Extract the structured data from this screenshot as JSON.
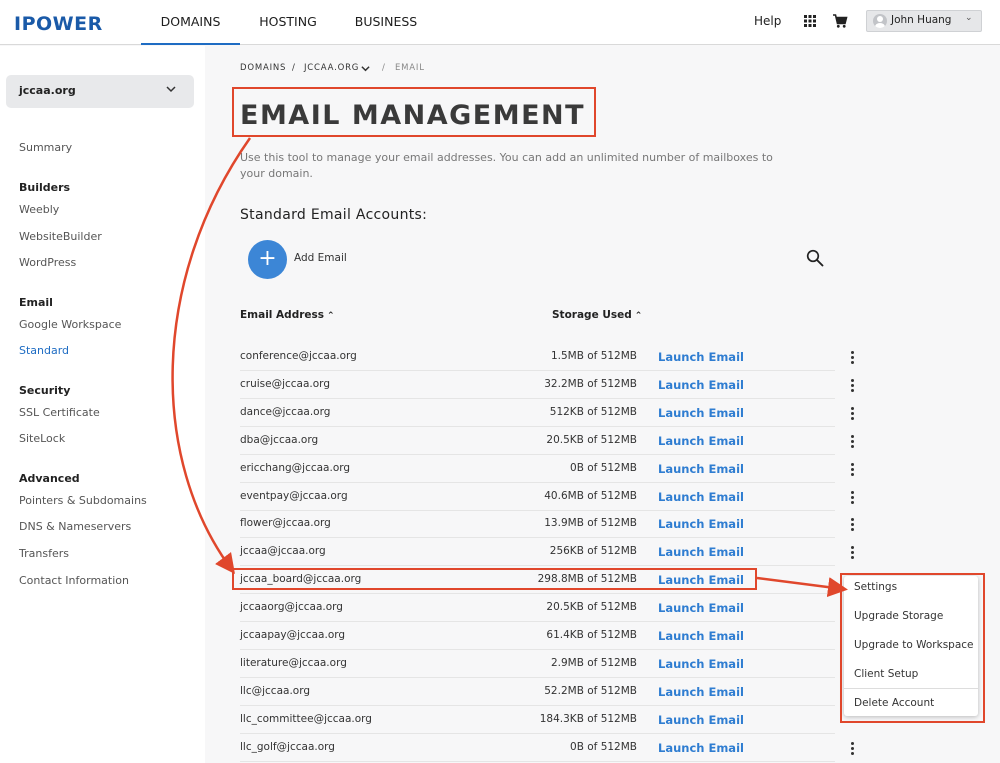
{
  "brand": {
    "logo_text": "IPOWER",
    "accent": "#1e6cc3",
    "annotation_color": "#e0472c"
  },
  "nav": {
    "tabs": [
      {
        "label": "DOMAINS",
        "active": true
      },
      {
        "label": "HOSTING",
        "active": false
      },
      {
        "label": "BUSINESS",
        "active": false
      }
    ],
    "help": "Help",
    "grid_icon": "apps-grid-icon",
    "cart_icon": "cart-icon",
    "user": "John Huang"
  },
  "sidebar": {
    "domain": "jccaa.org",
    "summary": "Summary",
    "groups": [
      {
        "heading": "Builders",
        "items": [
          "Weebly",
          "WebsiteBuilder",
          "WordPress"
        ]
      },
      {
        "heading": "Email",
        "items": [
          "Google Workspace",
          "Standard"
        ]
      },
      {
        "heading": "Security",
        "items": [
          "SSL Certificate",
          "SiteLock"
        ]
      },
      {
        "heading": "Advanced",
        "items": [
          "Pointers & Subdomains",
          "DNS & Nameservers",
          "Transfers",
          "Contact Information"
        ]
      }
    ],
    "active_item": "Standard"
  },
  "breadcrumb": {
    "first": "DOMAINS",
    "sep1": "/",
    "second": "JCCAA.ORG",
    "sep2": "/",
    "last": "EMAIL"
  },
  "main": {
    "title": "EMAIL MANAGEMENT",
    "description": "Use this tool to manage your email addresses. You can add an unlimited number of mailboxes to your domain.",
    "section_title": "Standard Email Accounts:",
    "add_email": "Add Email",
    "col_email": "Email Address",
    "col_storage": "Storage Used",
    "launch_label": "Launch Email"
  },
  "accounts": [
    {
      "email": "conference@jccaa.org",
      "storage": "1.5MB of 512MB"
    },
    {
      "email": "cruise@jccaa.org",
      "storage": "32.2MB of 512MB"
    },
    {
      "email": "dance@jccaa.org",
      "storage": "512KB of 512MB"
    },
    {
      "email": "dba@jccaa.org",
      "storage": "20.5KB of 512MB"
    },
    {
      "email": "ericchang@jccaa.org",
      "storage": "0B of 512MB"
    },
    {
      "email": "eventpay@jccaa.org",
      "storage": "40.6MB of 512MB"
    },
    {
      "email": "flower@jccaa.org",
      "storage": "13.9MB of 512MB"
    },
    {
      "email": "jccaa@jccaa.org",
      "storage": "256KB of 512MB"
    },
    {
      "email": "jccaa_board@jccaa.org",
      "storage": "298.8MB of 512MB"
    },
    {
      "email": "jccaaorg@jccaa.org",
      "storage": "20.5KB of 512MB"
    },
    {
      "email": "jccaapay@jccaa.org",
      "storage": "61.4KB of 512MB"
    },
    {
      "email": "literature@jccaa.org",
      "storage": "2.9MB of 512MB"
    },
    {
      "email": "llc@jccaa.org",
      "storage": "52.2MB of 512MB"
    },
    {
      "email": "llc_committee@jccaa.org",
      "storage": "184.3KB of 512MB"
    },
    {
      "email": "llc_golf@jccaa.org",
      "storage": "0B of 512MB"
    }
  ],
  "menu": {
    "items": [
      "Settings",
      "Upgrade Storage",
      "Upgrade to Workspace",
      "Client Setup"
    ],
    "danger": "Delete Account"
  }
}
